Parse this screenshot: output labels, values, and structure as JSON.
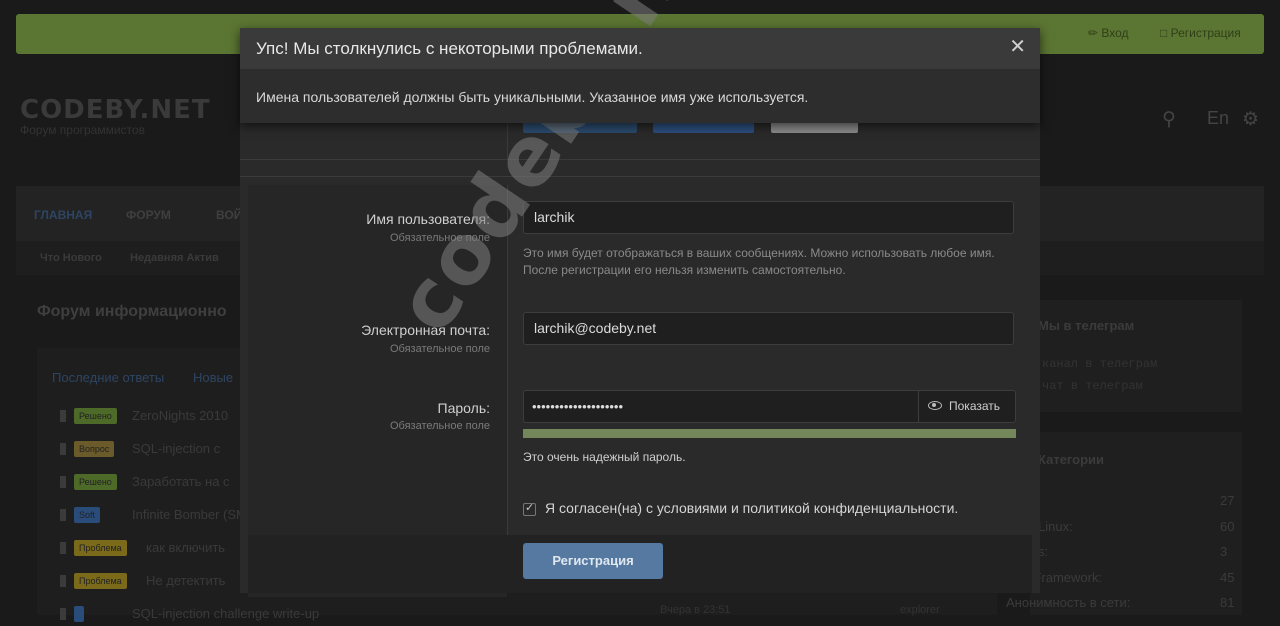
{
  "header": {
    "login_label": "Вход",
    "register_label": "Регистрация",
    "logo_text": "CODEBY.NET",
    "logo_subtitle": "Форум программистов",
    "lang_label": "En"
  },
  "nav": {
    "items": [
      "ГЛАВНАЯ",
      "ФОРУМ",
      "ВОЙ"
    ],
    "sub_items": [
      "Что Нового",
      "Недавняя Актив"
    ]
  },
  "forum": {
    "heading": "Форум информационно",
    "tabs": [
      "Последние ответы",
      "Новые"
    ],
    "threads": [
      {
        "prefix": "Решено",
        "prefix_color": "#4d6a28",
        "title": "ZeroNights 2010"
      },
      {
        "prefix": "Вопрос",
        "prefix_color": "#6b5a2a",
        "title": "SQL-injection с"
      },
      {
        "prefix": "Решено",
        "prefix_color": "#4d6a28",
        "title": "Заработать на с"
      },
      {
        "prefix": "Soft",
        "prefix_color": "#2a4c7a",
        "title": "Infinite Bomber (SM"
      },
      {
        "prefix": "Проблема",
        "prefix_color": "#7a6a1a",
        "title": "как включить"
      },
      {
        "prefix": "Проблема",
        "prefix_color": "#7a6a1a",
        "title": "Не детектить"
      },
      {
        "prefix": "",
        "prefix_color": "#2a4c7a",
        "title": "SQL-injection challenge write-up"
      }
    ],
    "last_meta": "Вчера в 23:51",
    "last_user": "explorer"
  },
  "sidebar": {
    "telegram_heading": "Мы в телеграм",
    "telegram_links": [
      "канал в телеграм",
      "чат в телеграм"
    ],
    "categories_heading": "Категории",
    "categories": [
      {
        "name": "",
        "count": "27"
      },
      {
        "name": "Linux:",
        "count": "60"
      },
      {
        "name": "s:",
        "count": "3"
      },
      {
        "name": "ploit Framework:",
        "count": "45"
      },
      {
        "name": "Анонимность в сети:",
        "count": "81"
      }
    ]
  },
  "error_dialog": {
    "title": "Упс! Мы столкнулись с некоторыми проблемами.",
    "message": "Имена пользователей должны быть уникальными. Указанное имя уже используется."
  },
  "form": {
    "username": {
      "label": "Имя пользователя:",
      "required": "Обязательное поле",
      "value": "larchik",
      "hint": "Это имя будет отображаться в ваших сообщениях. Можно использовать любое имя. После регистрации его нельзя изменить самостоятельно."
    },
    "email": {
      "label": "Электронная почта:",
      "required": "Обязательное поле",
      "value": "larchik@codeby.net"
    },
    "password": {
      "label": "Пароль:",
      "required": "Обязательное поле",
      "value": "••••••••••••••••••••",
      "show_label": "Показать",
      "strength_text": "Это очень надежный пароль.",
      "strength_fraction": 1.0
    },
    "agree_label": "Я согласен(на) с условиями и политикой конфиденциальности.",
    "agree_checked": true,
    "submit_label": "Регистрация"
  },
  "watermark": "codeby.net",
  "colors": {
    "accent_bar": "#5b7532",
    "submit": "#5579a0",
    "strength": "#74875a"
  }
}
